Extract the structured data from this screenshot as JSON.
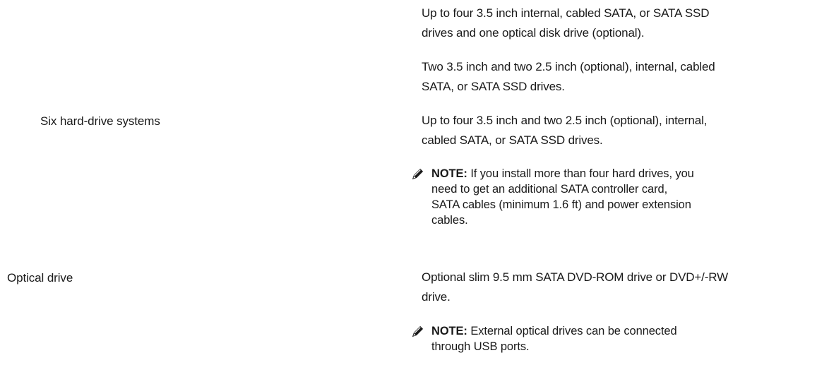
{
  "rows": [
    {
      "label": "",
      "value_lines": [
        "Up to four 3.5 inch internal, cabled SATA, or SATA SSD",
        "drives and one optical disk drive (optional)."
      ]
    },
    {
      "label": "",
      "value_lines": [
        "Two 3.5 inch and two 2.5 inch (optional), internal, cabled",
        "SATA, or SATA SSD drives."
      ]
    },
    {
      "label": "Six hard-drive systems",
      "value_lines": [
        "Up to four 3.5 inch and two 2.5 inch (optional), internal,",
        "cabled SATA, or SATA SSD drives."
      ]
    },
    {
      "label": "Optical drive",
      "value_lines": [
        "Optional slim 9.5 mm SATA DVD-ROM drive or DVD+/-RW",
        "drive."
      ]
    }
  ],
  "notes": [
    {
      "icon": "note-pencil-icon",
      "prefix": "NOTE:",
      "lines": [
        "If you install more than four hard drives, you",
        "need to get an additional SATA controller card,",
        "SATA cables (minimum 1.6 ft) and power extension",
        "cables."
      ]
    },
    {
      "icon": "note-pencil-icon",
      "prefix": "NOTE:",
      "lines": [
        "External optical drives can be connected",
        "through USB ports."
      ]
    }
  ]
}
